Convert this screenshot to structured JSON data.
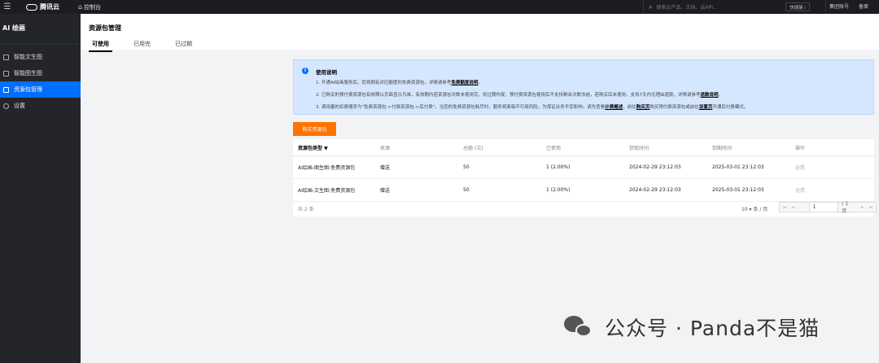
{
  "topbar": {
    "brand": "腾讯云",
    "console_label": "控制台",
    "search_placeholder": "搜索云产品、文档、云API...",
    "shortcut": "快捷键 /",
    "group_account": "集团账号",
    "filing": "备案"
  },
  "sidebar": {
    "title": "AI 绘画",
    "items": [
      {
        "label": "智能文生图",
        "icon": "text-image-icon",
        "active": false
      },
      {
        "label": "智能图生图",
        "icon": "image-image-icon",
        "active": false
      },
      {
        "label": "资源包管理",
        "icon": "package-icon",
        "active": true
      },
      {
        "label": "设置",
        "icon": "settings-icon",
        "active": false
      }
    ]
  },
  "header": {
    "title": "资源包管理",
    "tabs": [
      {
        "label": "可使用",
        "active": true
      },
      {
        "label": "已用完",
        "active": false
      },
      {
        "label": "已过期",
        "active": false
      }
    ]
  },
  "notice": {
    "title": "使用说明",
    "line1_text": "1. 开通AI绘画服务后，您将拥有对应额度的免费资源包，详情请参考",
    "line1_link": "免费额度说明",
    "line1_end": "。",
    "line2_text": "2. 已购买的预付费资源包有效期以页面显示为准，有效期内若资源包次数未使用完，则过期作废；预付费资源包使用后不支持剩余次数冻结，若购买后未使用，支持7天内无理由退款，详情请参考",
    "line2_link": "退款说明",
    "line2_end": "。",
    "line3_text": "3. 调用量的扣费顺序为\"免费资源包->付费资源包->后付费\"，当您的免费资源包耗尽时，服务将面临不可用风险，为保证业务不受影响，请先查看",
    "line3_link1": "计费概述",
    "line3_mid1": "，前往",
    "line3_link2": "购买页",
    "line3_mid2": "购买预付费资源包或前往",
    "line3_link3": "设置页",
    "line3_end": "开通后付费模式。"
  },
  "buy_button": "购买资源包",
  "table": {
    "headers": [
      "资源包类型 ▼",
      "来源",
      "总额 (次)",
      "已使用",
      "获取时间",
      "到期时间",
      "操作"
    ],
    "rows": [
      [
        "AI绘画-图生图-免费资源包",
        "赠送",
        "50",
        "1 (2.00%)",
        "2024-02-29 23:12:03",
        "2025-03-01 23:12:03",
        "退费"
      ],
      [
        "AI绘画-文生图-免费资源包",
        "赠送",
        "50",
        "1 (2.00%)",
        "2024-02-29 23:12:03",
        "2025-03-01 23:12:03",
        "退费"
      ]
    ],
    "total": "共 2 条",
    "per_page": "10 ▾ 条 / 页",
    "page_value": "1",
    "page_total": "/ 1 页"
  },
  "watermark": "公众号 · Panda不是猫",
  "colors": {
    "accent": "#006eff",
    "buy": "#ff7200",
    "notice_bg": "#d5e7ff"
  }
}
